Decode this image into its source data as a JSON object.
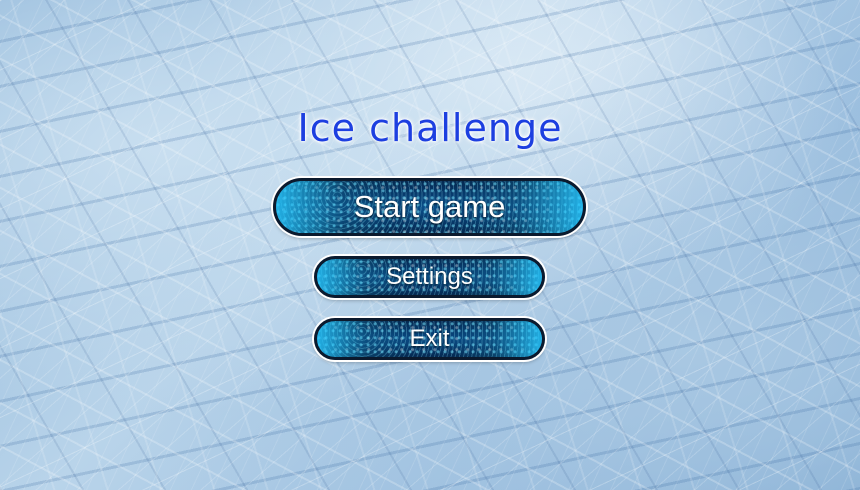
{
  "title": "Ice challenge",
  "menu": {
    "start_label": "Start game",
    "settings_label": "Settings",
    "exit_label": "Exit"
  },
  "colors": {
    "title": "#1d3fe0",
    "button_fill": "#06315e",
    "button_glow": "#1fc4ff",
    "button_border": "#0b1a2e",
    "button_text": "#ffffff"
  }
}
